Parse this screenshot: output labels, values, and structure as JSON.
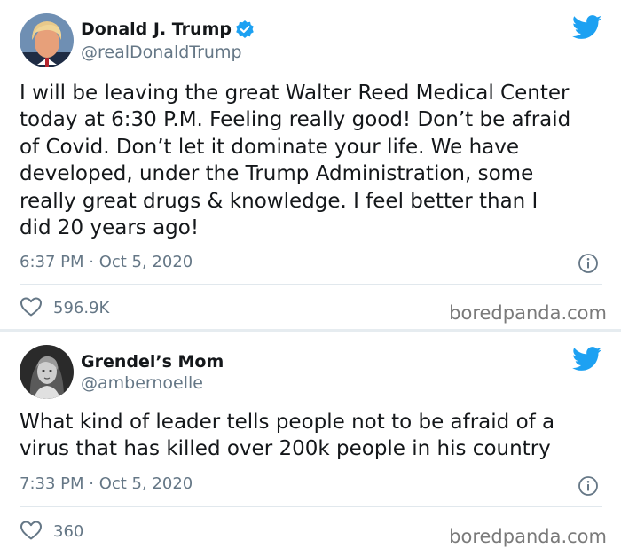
{
  "tweets": [
    {
      "display_name": "Donald J. Trump",
      "verified": true,
      "handle": "@realDonaldTrump",
      "text": "I will be leaving the great Walter Reed Medical Center\ntoday at 6:30 P.M. Feeling really good! Don’t be afraid\nof Covid. Don’t let it dominate your life. We have\ndeveloped, under the Trump Administration, some\nreally great drugs & knowledge. I feel better than I\ndid 20 years ago!",
      "timestamp": "6:37 PM · Oct 5, 2020",
      "likes": "596.9K",
      "watermark": "boredpanda.com"
    },
    {
      "display_name": "Grendel’s Mom",
      "verified": false,
      "handle": "@ambernoelle",
      "text": "What kind of leader tells people not to be afraid of a\nvirus that has killed over 200k people in his country",
      "timestamp": "7:33 PM · Oct 5, 2020",
      "likes": "360",
      "watermark": "boredpanda.com"
    }
  ],
  "colors": {
    "twitter_blue": "#1da1f2",
    "text": "#14171a",
    "secondary": "#657786",
    "divider": "#e1e8ed"
  },
  "icons": {
    "brand": "twitter-bird-icon",
    "verified": "verified-badge-icon",
    "info": "info-icon",
    "like": "heart-icon"
  }
}
